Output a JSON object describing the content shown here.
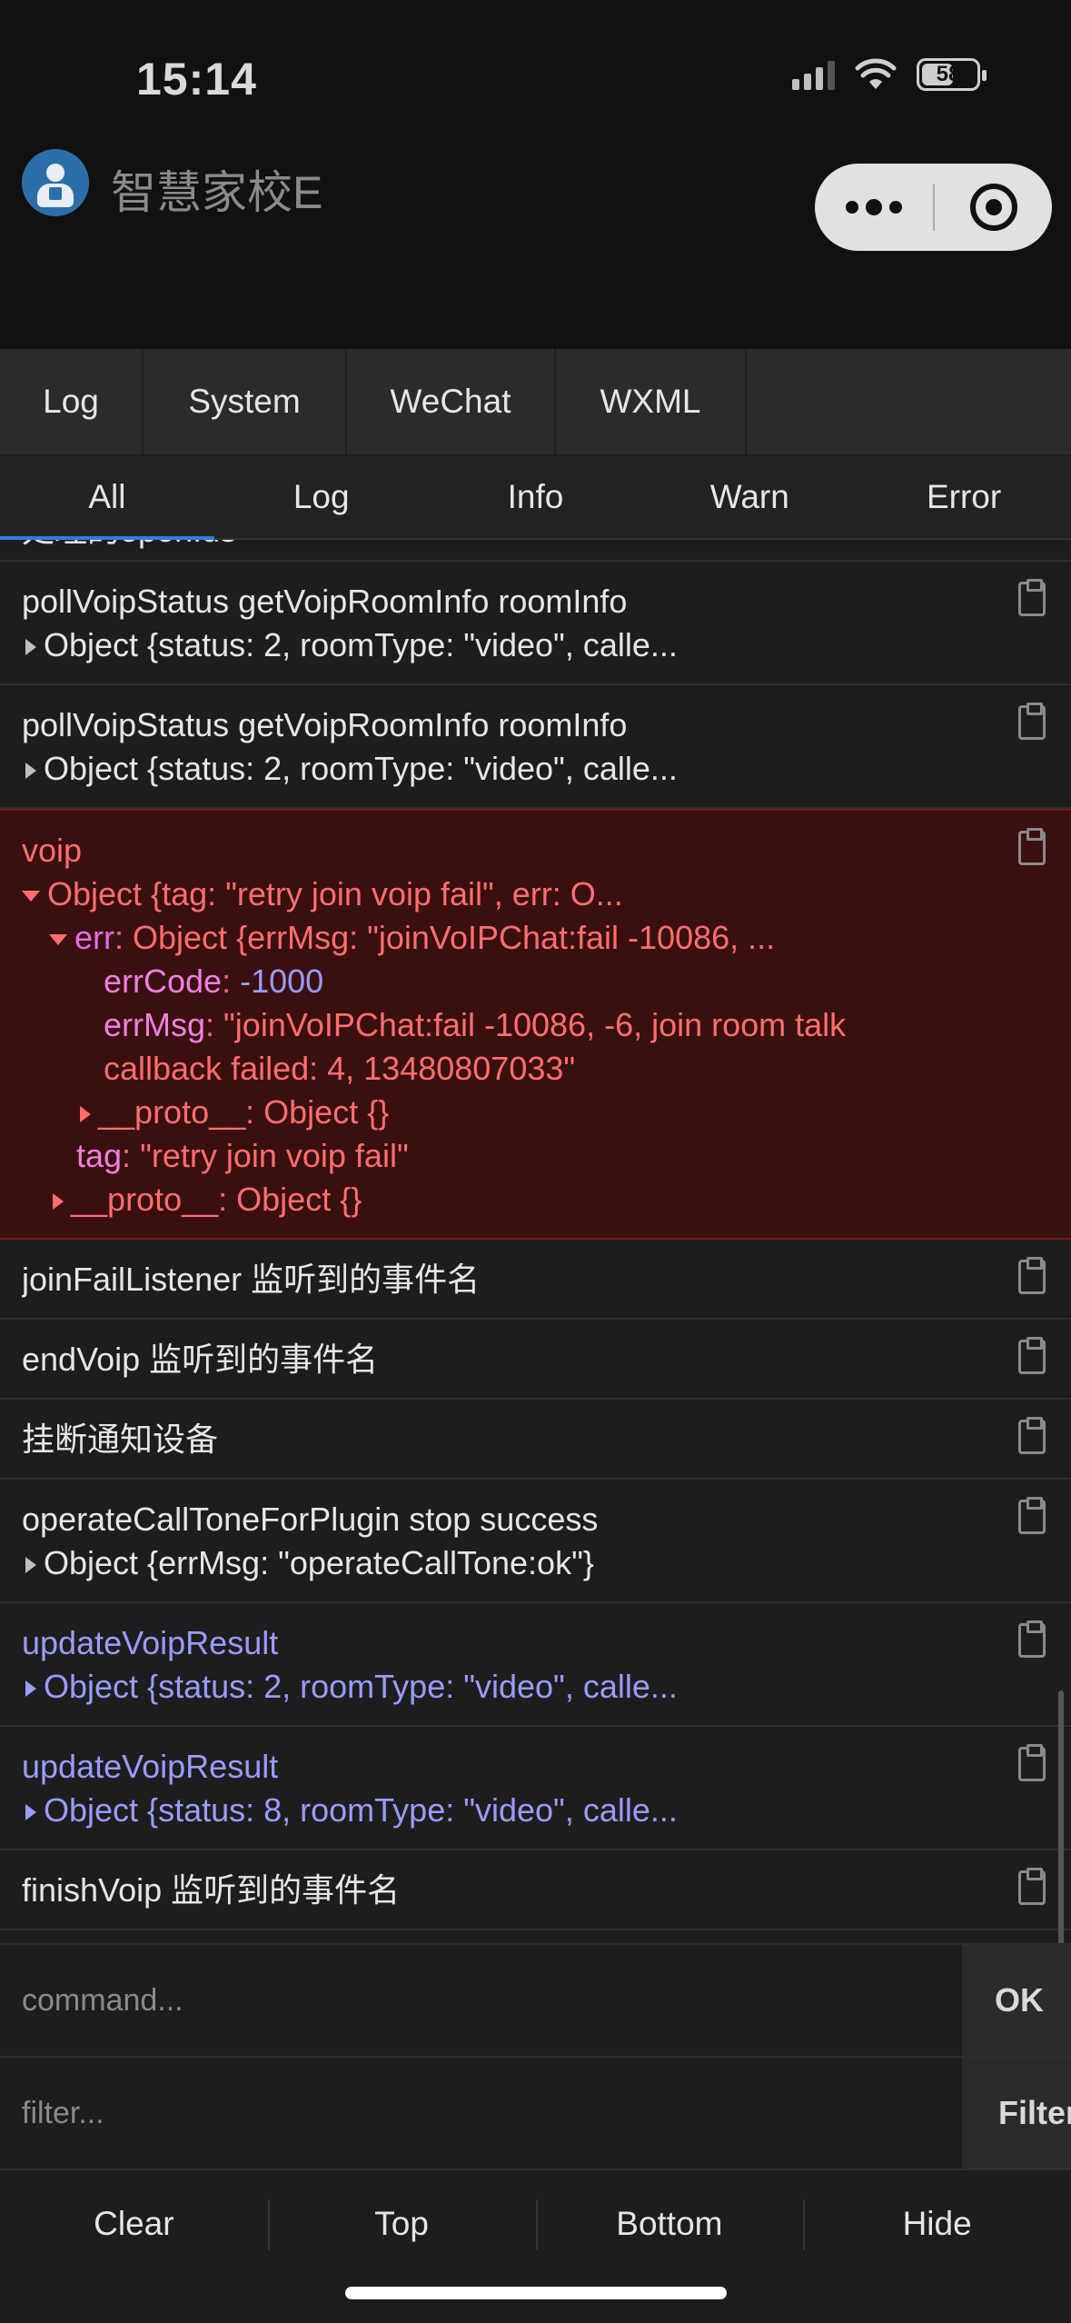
{
  "status_bar": {
    "time": "15:14",
    "battery": "58"
  },
  "header": {
    "title": "智慧家校E"
  },
  "tabs": [
    "Log",
    "System",
    "WeChat",
    "WXML"
  ],
  "subtabs": [
    "All",
    "Log",
    "Info",
    "Warn",
    "Error"
  ],
  "log": {
    "partial_top": "处理的openIds",
    "entry1_title": "pollVoipStatus getVoipRoomInfo roomInfo",
    "entry1_obj": "Object {status: 2, roomType: \"video\", calle...",
    "entry2_title": "pollVoipStatus getVoipRoomInfo roomInfo",
    "entry2_obj": "Object {status: 2, roomType: \"video\", calle...",
    "error_title": "voip",
    "error_obj": "Object {tag: \"retry join voip fail\", err: O...",
    "err_key": "err",
    "err_obj": "Object {errMsg: \"joinVoIPChat:fail -10086, ...",
    "errcode_key": "errCode",
    "errcode_val": "-1000",
    "errmsg_key": "errMsg",
    "errmsg_val1": "\"joinVoIPChat:fail -10086, -6, join room talk",
    "errmsg_val2": "callback failed: 4, 13480807033\"",
    "proto_key": "__proto__",
    "proto_val": "Object {}",
    "tag_key": "tag",
    "tag_val": "\"retry join voip fail\"",
    "entry3": "joinFailListener 监听到的事件名",
    "entry4": "endVoip 监听到的事件名",
    "entry5": "挂断通知设备",
    "entry6_title": "operateCallToneForPlugin stop success",
    "entry6_obj": "Object {errMsg: \"operateCallTone:ok\"}",
    "entry7_title": "updateVoipResult",
    "entry7_obj": "Object {status: 2, roomType: \"video\", calle...",
    "entry8_title": "updateVoipResult",
    "entry8_obj": "Object {status: 8, roomType: \"video\", calle...",
    "entry9": "finishVoip 监听到的事件名"
  },
  "command": {
    "placeholder": "command...",
    "ok_label": "OK"
  },
  "filter": {
    "placeholder": "filter...",
    "button_label": "Filter"
  },
  "toolbar": {
    "clear": "Clear",
    "top": "Top",
    "bottom": "Bottom",
    "hide": "Hide"
  },
  "colors": {
    "accent": "#2f7de1",
    "error_bg": "#3a0f0f",
    "error_text": "#ff6e6e",
    "info_text": "#9a9cff"
  }
}
